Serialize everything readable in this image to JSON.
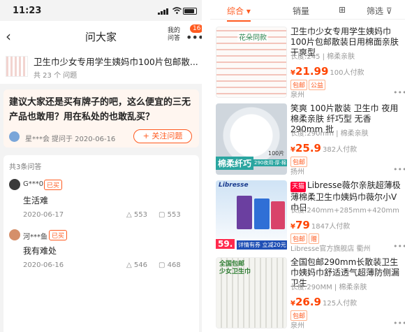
{
  "status_bar": {
    "time": "11:23"
  },
  "nav": {
    "title": "问大家",
    "my_questions": "我的\n问答",
    "badge": "16"
  },
  "product": {
    "title": "卫生巾少女专用学生姨妈巾100片包邮散...",
    "count": "共 23 个 问题"
  },
  "question": {
    "text": "建议大家还是买有牌子的吧，这么便宜的三无产品也敢用？用在私处的也敢乱买？",
    "asker": "星***会",
    "asked_on": "提问于 2020-06-16",
    "follow_label": "+ 关注问题"
  },
  "answers": {
    "count_label": "共3条问答",
    "items": [
      {
        "user": "G***0",
        "tag": "已买",
        "text": "生活难",
        "date": "2020-06-17",
        "likes": "553",
        "comments": "553"
      },
      {
        "user": "河***鱼",
        "tag": "已买",
        "text": "我有难处",
        "date": "2020-06-16",
        "likes": "546",
        "comments": "468"
      }
    ]
  },
  "filter": {
    "tabs": [
      {
        "label": "综合 ▾",
        "active": true
      },
      {
        "label": "销量",
        "active": false
      },
      {
        "label": "⊞",
        "active": false
      },
      {
        "label": "筛选 ⊽",
        "active": false
      }
    ]
  },
  "products": [
    {
      "name": "卫生巾少女专用学生姨妈巾100片包邮散装日用棉面亲肤干爽型",
      "spec": "长度:245 | 棉柔亲肤",
      "price_sym": "¥",
      "price": "21.99",
      "sold": "100人付款",
      "badges": [
        "包邮",
        "公益"
      ],
      "location": "泉州",
      "img_label": "花朵同款"
    },
    {
      "name": "笑爽 100片散装 卫生巾 夜用 棉柔亲肤 纤巧型 无香 290mm 批",
      "spec": "长度:290mm | 棉柔亲肤",
      "price_sym": "¥",
      "price": "25.9",
      "sold": "382人付款",
      "badges": [
        "包邮"
      ],
      "location": "扬州",
      "img_label": "棉柔纤巧",
      "img_sub": "290夜用·厚·棉",
      "img_count": "100片"
    },
    {
      "tianmao": "天猫",
      "name": "Libresse薇尔亲肤超薄极薄棉柔卫生巾姨妈巾薇尔小V巾日",
      "spec": "长度:240mm+285mm+420mm",
      "price_sym": "¥",
      "price": "79",
      "sold": "1847人付款",
      "badges": [
        "包邮",
        "赠"
      ],
      "location": "Libresse官方旗舰店 衢州",
      "img_brand": "Libresse",
      "img_price": "59.",
      "img_promo": "详情有券 立减20元"
    },
    {
      "name": "全国包邮290mm长散装卫生巾姨妈巾舒适透气超薄防侧漏卫生",
      "spec": "长度:290MM | 棉柔亲肤",
      "price_sym": "¥",
      "price": "26.9",
      "sold": "125人付款",
      "badges": [
        "包邮"
      ],
      "location": "泉州",
      "img_label": "全国包邮\n少女卫生巾"
    }
  ],
  "colors": {
    "accent": "#ff5a1f",
    "price": "#ff4400",
    "tmall": "#ff0036"
  }
}
